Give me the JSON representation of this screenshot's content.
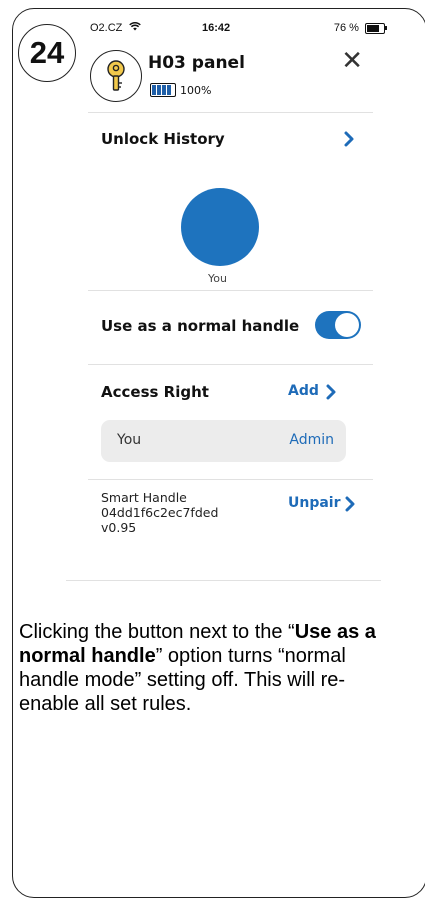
{
  "step": {
    "number": "24"
  },
  "status_bar": {
    "carrier": "O2.CZ",
    "time": "16:42",
    "battery": "76 %"
  },
  "header": {
    "title": "H03 panel",
    "battery_percent": "100%",
    "close_label": "✕"
  },
  "unlock_history": {
    "label": "Unlock History",
    "user_label": "You"
  },
  "normal_handle": {
    "label": "Use as a normal handle",
    "enabled": true
  },
  "access_right": {
    "label": "Access Right",
    "add_label": "Add",
    "rows": [
      {
        "name": "You",
        "role": "Admin"
      }
    ]
  },
  "device": {
    "name": "Smart Handle",
    "id": "04dd1f6c2ec7fded",
    "version": "v0.95",
    "unpair_label": "Unpair"
  },
  "caption": {
    "part1": "Clicking the button next to the “",
    "bold": "Use as a normal handle",
    "part2": "” option turns “normal handle mode” setting off. This will re-enable all set rules."
  },
  "colors": {
    "accent": "#1e73be",
    "link": "#1e6bb8"
  }
}
